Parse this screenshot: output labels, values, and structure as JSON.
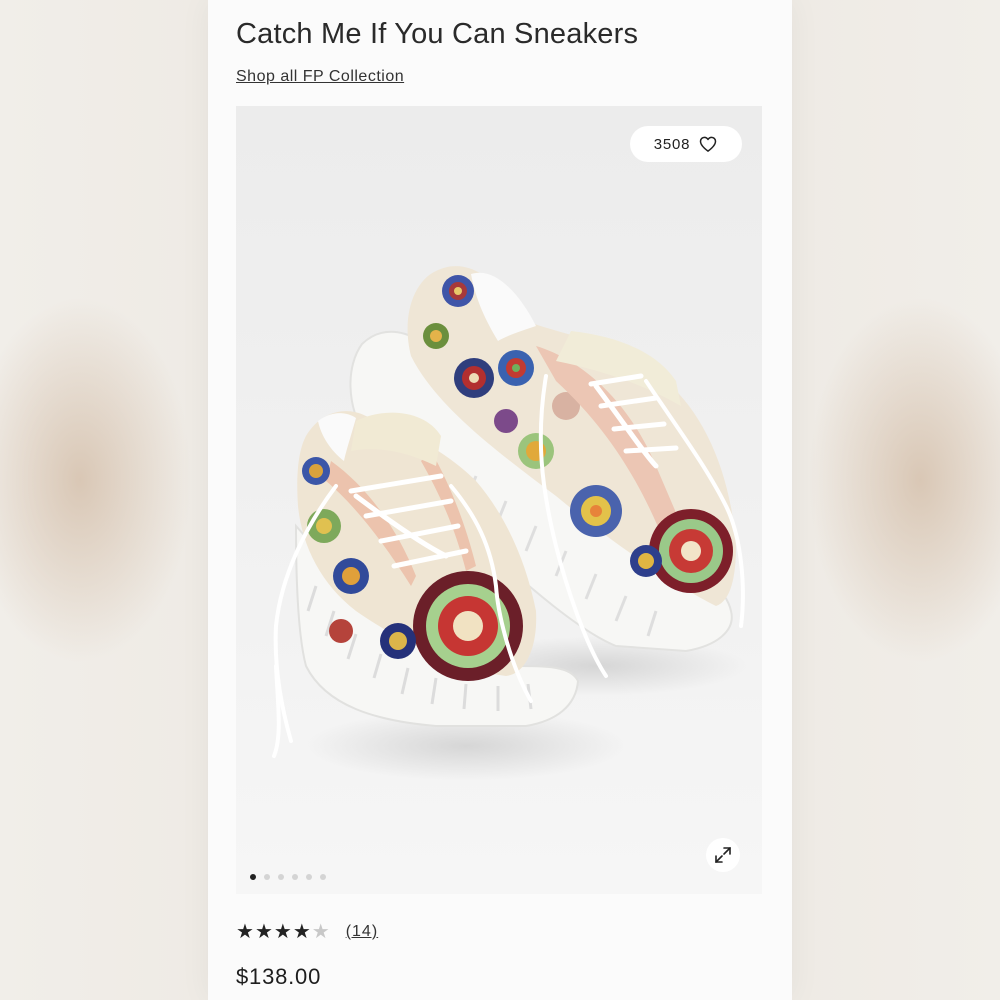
{
  "product": {
    "title": "Catch Me If You Can Sneakers",
    "collection_link": "Shop all FP Collection",
    "likes": "3508",
    "rating": 4,
    "rating_max": 5,
    "review_count": "(14)",
    "price": "$138.00"
  },
  "gallery": {
    "image_count": 6,
    "active_index": 0
  },
  "icons": {
    "like": "heart-icon",
    "expand": "expand-icon",
    "star": "star-icon"
  }
}
